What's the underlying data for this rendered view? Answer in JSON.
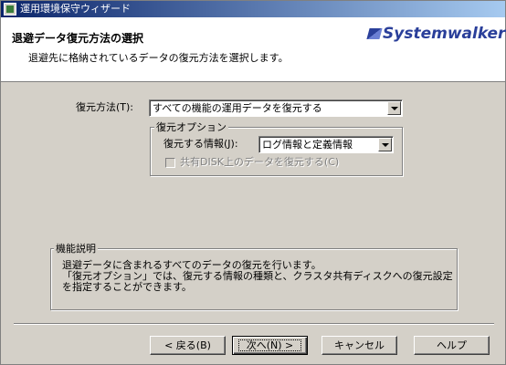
{
  "window": {
    "title": "運用環境保守ウィザード"
  },
  "header": {
    "title": "退避データ復元方法の選択",
    "subtitle": "退避先に格納されているデータの復元方法を選択します。",
    "logo": "Systemwalker"
  },
  "restore_method": {
    "label": "復元方法(T):",
    "value": "すべての機能の運用データを復元する"
  },
  "restore_options": {
    "legend": "復元オプション",
    "info_label": "復元する情報(J):",
    "info_value": "ログ情報と定義情報",
    "shared_disk_label": "共有DISK上のデータを復元する(C)",
    "shared_disk_checked": false,
    "shared_disk_enabled": false
  },
  "description": {
    "legend": "機能説明",
    "lines": [
      "退避データに含まれるすべてのデータの復元を行います。",
      "「復元オプション」では、復元する情報の種類と、クラスタ共有ディスクへの復元設定",
      "を指定することができます。"
    ]
  },
  "buttons": {
    "back": "< 戻る(B)",
    "next": "次へ(N) >",
    "cancel": "キャンセル",
    "help": "ヘルプ"
  }
}
